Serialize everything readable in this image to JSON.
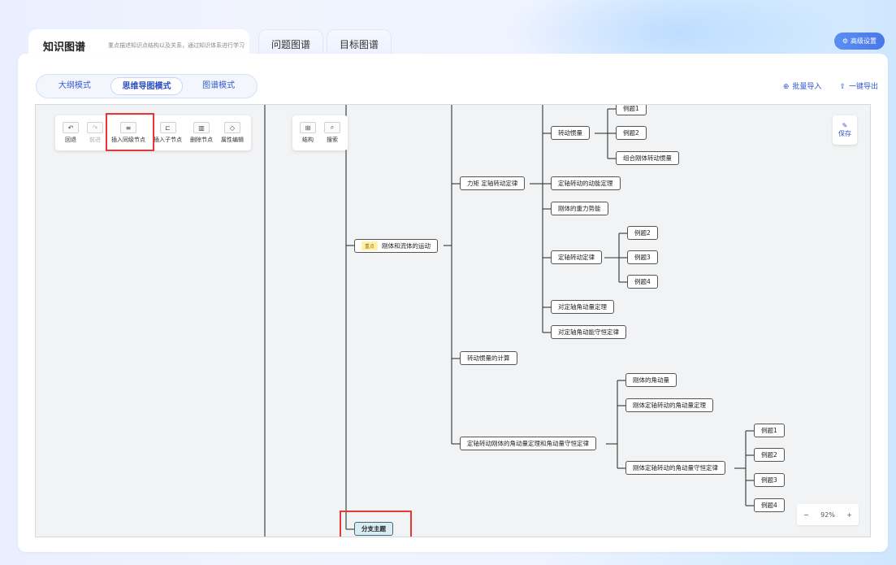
{
  "tabs": {
    "knowledge": "知识图谱",
    "knowledge_desc": "重点描述知识点结构以及关系，通过知识体系进行学习",
    "question": "问题图谱",
    "goal": "目标图谱"
  },
  "advanced_settings": "高级设置",
  "modes": [
    "大纲模式",
    "思维导图模式",
    "图谱模式"
  ],
  "actions": {
    "import": "批量导入",
    "export": "一键导出"
  },
  "toolbar": {
    "undo": "回退",
    "redo": "前进",
    "insert_sibling": "插入同级节点",
    "insert_child": "插入子节点",
    "delete_node": "删除节点",
    "edit_attr": "属性编辑",
    "structure": "结构",
    "search": "搜索"
  },
  "save": "保存",
  "zoom": {
    "minus": "−",
    "value": "92%",
    "plus": "+"
  },
  "mindmap": {
    "root": {
      "tag": "重点",
      "label": "刚体和流体的运动"
    },
    "n_torque": "力矩 定轴转动定律",
    "n_inertia": "转动惯量",
    "ex1": "例题1",
    "ex2": "例题2",
    "combo": "组合刚体转动惯量",
    "n_ke": "定轴转动的动能定理",
    "n_pe": "刚体的重力势能",
    "n_law": "定轴转动定律",
    "law_ex2": "例题2",
    "law_ex3": "例题3",
    "law_ex4": "例题4",
    "n_am_thm": "对定轴角动量定理",
    "n_am_cons": "对定轴角动能守恒定律",
    "n_calc": "转动惯量的计算",
    "n_big": "定轴转动刚体的角动量定理和角动量守恒定律",
    "n_am": "刚体的角动量",
    "n_am_law": "刚体定轴转动的角动量定理",
    "n_am_keep": "刚体定轴转动的角动量守恒定律",
    "k_ex1": "例题1",
    "k_ex2": "例题2",
    "k_ex3": "例题3",
    "k_ex4": "例题4",
    "branch": "分支主题"
  }
}
